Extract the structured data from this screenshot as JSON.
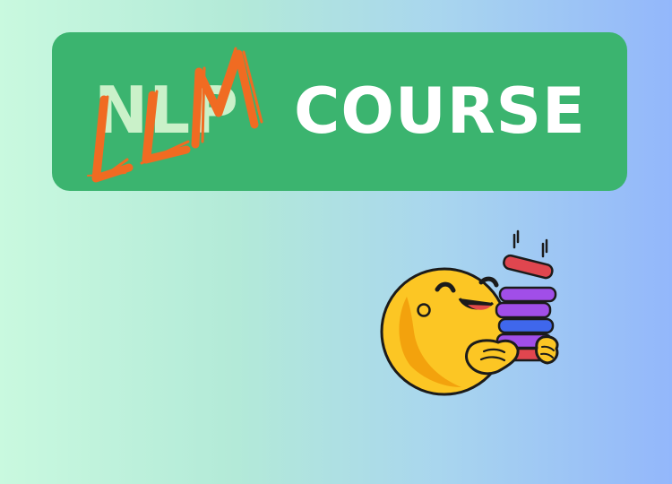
{
  "banner": {
    "crossed_word": "NLP",
    "scribbled_word": "LLM",
    "main_word": "COURSE"
  },
  "colors": {
    "card": "#3bb46f",
    "scribble": "#f06b22",
    "crossed_word": "#d7f7d1",
    "face": "#fcc624",
    "books": [
      "#e0464f",
      "#a14ee8",
      "#a14ee8",
      "#3f67ec",
      "#a14ee8",
      "#e0464f"
    ]
  },
  "mascot": {
    "icon": "hugging-face-with-books-icon"
  }
}
